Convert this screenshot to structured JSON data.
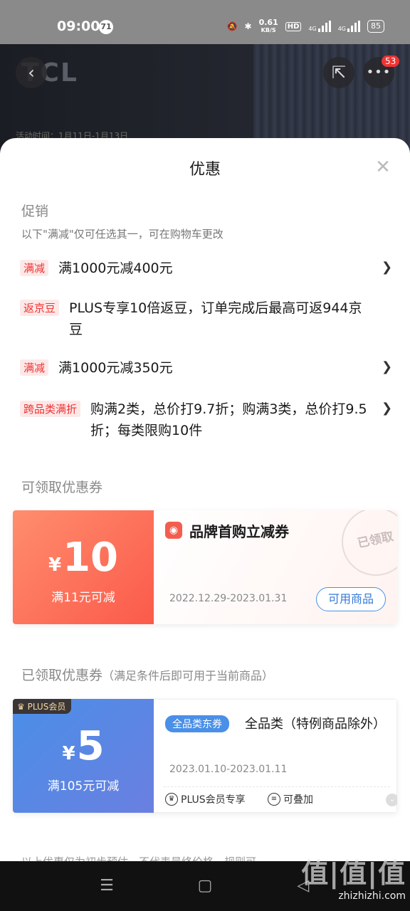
{
  "status_bar": {
    "time": "09:00",
    "notif_count": "71",
    "net_speed": "0.61",
    "net_unit": "KB/S",
    "hd": "HD",
    "sig1": "4G",
    "sig2": "4G",
    "battery": "85"
  },
  "background": {
    "brand_logo": "TCL",
    "event_text": "活动时间：1月11日-1月13日",
    "cart_badge": "53"
  },
  "sheet": {
    "title": "优惠",
    "close_icon": "close-icon"
  },
  "promotions": {
    "title": "促销",
    "subtitle": "以下\"满减\"仅可任选其一，可在购物车更改",
    "items": [
      {
        "tag": "满减",
        "text": "满1000元减400元",
        "arrow": "❯"
      },
      {
        "tag": "返京豆",
        "text": "PLUS专享10倍返豆，订单完成后最高可返944京豆",
        "arrow": ""
      },
      {
        "tag": "满减",
        "text": "满1000元减350元",
        "arrow": "❯"
      },
      {
        "tag": "跨品类满折",
        "text": "购满2类，总价打9.7折；购满3类，总价打9.5折；每类限购10件",
        "arrow": "❯"
      }
    ]
  },
  "available_coupons": {
    "title": "可领取优惠券",
    "coupon": {
      "currency": "¥",
      "amount": "10",
      "condition": "满11元可减",
      "name": "品牌首购立减券",
      "dates": "2022.12.29-2023.01.31",
      "button": "可用商品",
      "stamp": "已领取",
      "accent_color": "#fb5a4a"
    }
  },
  "claimed_coupons": {
    "title": "已领取优惠券",
    "subtitle": "（满足条件后即可用于当前商品）",
    "coupon": {
      "badge": "PLUS会员",
      "currency": "¥",
      "amount": "5",
      "condition": "满105元可减",
      "tag": "全品类东券",
      "name": "全品类（特例商品除外）",
      "dates": "2023.01.10-2023.01.11",
      "feature1": "PLUS会员专享",
      "feature2": "可叠加",
      "accent_color": "#4a8fe8"
    }
  },
  "footer_note": "以上优惠仅为初步预估，不代表最终价格，规则可",
  "watermark": {
    "logo": "值|值|值",
    "url": "zhizhizhi.com"
  }
}
